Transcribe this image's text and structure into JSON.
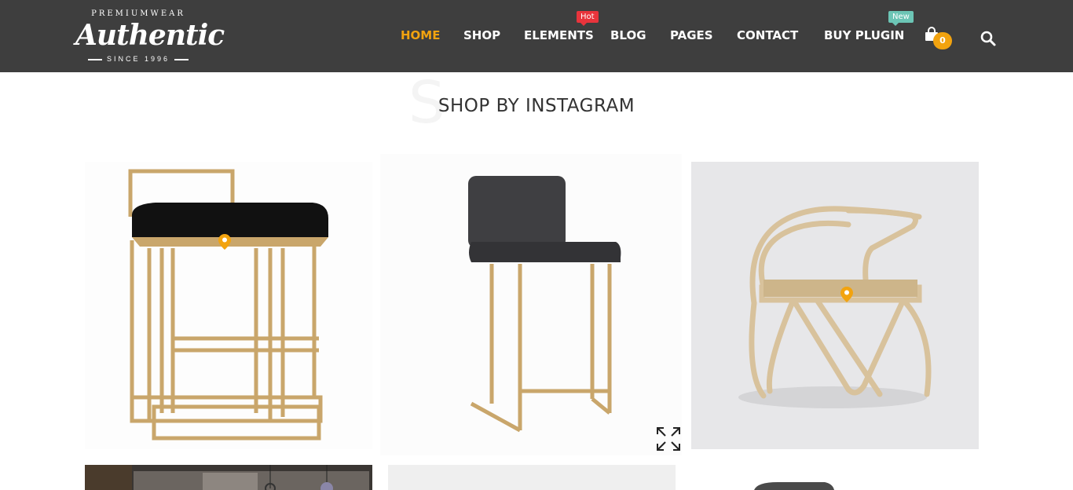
{
  "header": {
    "logo": {
      "top_text": "PREMIUMWEAR",
      "main_text": "Authentic",
      "bottom_text": "SINCE 1996"
    },
    "nav": [
      {
        "label": "HOME",
        "active": true
      },
      {
        "label": "SHOP"
      },
      {
        "label": "ELEMENTS",
        "badge": "Hot"
      },
      {
        "label": "BLOG"
      },
      {
        "label": "PAGES"
      },
      {
        "label": "CONTACT"
      },
      {
        "label": "BUY PLUGIN",
        "badge": "New"
      }
    ],
    "cart": {
      "icon": "shopping-bag-icon",
      "count": "0"
    },
    "search": {
      "icon": "search-icon"
    }
  },
  "section": {
    "ghost_letter": "S",
    "title": "SHOP BY INSTAGRAM"
  },
  "gallery": {
    "items": [
      {
        "name": "black velvet bar stool with gold frame",
        "has_pin": true
      },
      {
        "name": "grey velvet bar stool with gold legs",
        "has_expand": true
      },
      {
        "name": "rattan bentwood armchair",
        "has_pin": true
      },
      {
        "name": "interior with pendant lights"
      },
      {
        "name": "light grey product image"
      },
      {
        "name": "dark chair seat on white"
      }
    ]
  },
  "colors": {
    "header_bg": "#3e3e3e",
    "accent": "#f2a30f",
    "hot_badge": "#e8343c",
    "new_badge": "#6cc5b5"
  }
}
